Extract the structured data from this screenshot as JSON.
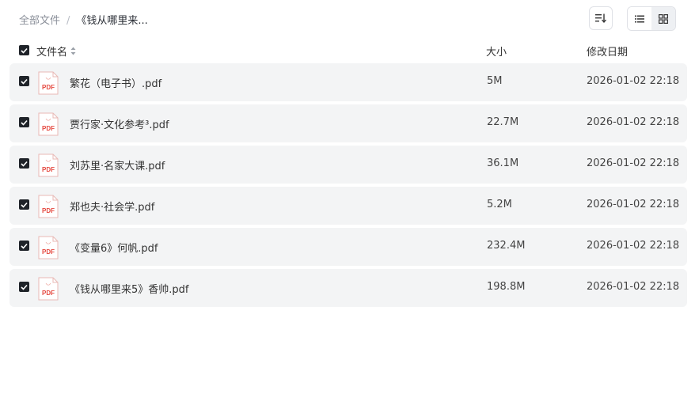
{
  "breadcrumb": {
    "root": "全部文件",
    "separator": "/",
    "current": "《钱从哪里来..."
  },
  "toolbar": {
    "sort_icon": "sort-icon",
    "list_view_icon": "list-view-icon",
    "grid_view_icon": "grid-view-icon"
  },
  "table": {
    "header": {
      "name": "文件名",
      "size": "大小",
      "date": "修改日期"
    },
    "rows": [
      {
        "name": "繁花（电子书）.pdf",
        "size": "5M",
        "date": "2026-01-02 22:18",
        "checked": true
      },
      {
        "name": "贾行家·文化参考³.pdf",
        "size": "22.7M",
        "date": "2026-01-02 22:18",
        "checked": true
      },
      {
        "name": "刘苏里·名家大课.pdf",
        "size": "36.1M",
        "date": "2026-01-02 22:18",
        "checked": true
      },
      {
        "name": "郑也夫·社会学.pdf",
        "size": "5.2M",
        "date": "2026-01-02 22:18",
        "checked": true
      },
      {
        "name": "《变量6》何帆.pdf",
        "size": "232.4M",
        "date": "2026-01-02 22:18",
        "checked": true
      },
      {
        "name": "《钱从哪里来5》香帅.pdf",
        "size": "198.8M",
        "date": "2026-01-02 22:18",
        "checked": true
      }
    ],
    "file_icon_label": "PDF"
  },
  "colors": {
    "row_bg": "#f3f4f5",
    "checkbox": "#1f2329",
    "pdf_red": "#e5483f"
  }
}
